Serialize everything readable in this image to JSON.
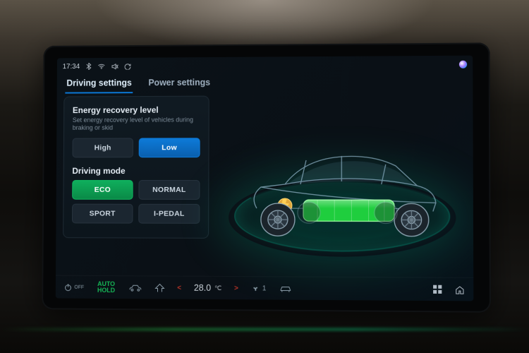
{
  "status": {
    "time": "17:34"
  },
  "tabs": {
    "driving": "Driving settings",
    "power": "Power settings",
    "active": "driving"
  },
  "energy_recovery": {
    "title": "Energy recovery level",
    "desc": "Set energy recovery level of vehicles during braking or skid",
    "options": {
      "high": "High",
      "low": "Low"
    },
    "selected": "low"
  },
  "driving_mode": {
    "title": "Driving mode",
    "options": {
      "eco": "ECO",
      "normal": "NORMAL",
      "sport": "SPORT",
      "ipedal": "I-PEDAL"
    },
    "selected": "eco"
  },
  "dock": {
    "off_label": "OFF",
    "auto_hold": "AUTO HOLD",
    "temperature_value": "28.0",
    "temperature_unit": "℃",
    "fan_level": "1"
  },
  "colors": {
    "accent_blue": "#0d7ad8",
    "accent_green": "#10b560",
    "battery": "#22e24a"
  }
}
